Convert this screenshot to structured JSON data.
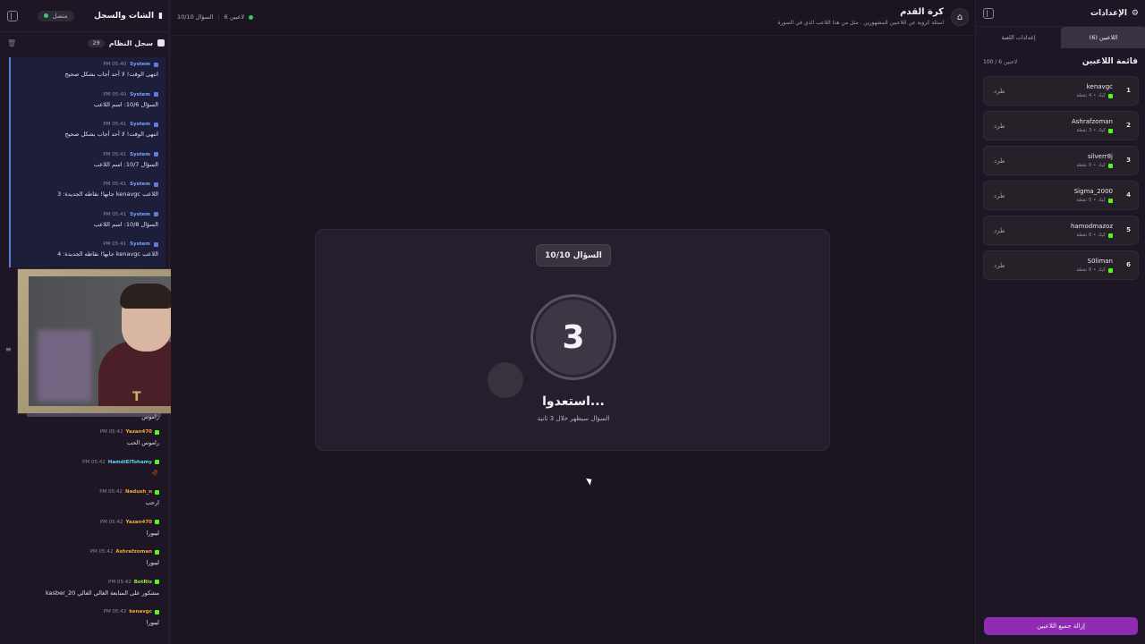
{
  "left": {
    "title": "الشات والسجل",
    "connection": "متصل",
    "syslog_title": "سجل النظام",
    "syslog_count": "29",
    "system_messages": [
      {
        "author": "System",
        "time": "PM 05:40",
        "text": "انتهى الوقت! لا أحد أجاب بشكل صحيح"
      },
      {
        "author": "System",
        "time": "PM 05:40",
        "text": "السؤال 10/6: اسم اللاعب"
      },
      {
        "author": "System",
        "time": "PM 05:41",
        "text": "انتهى الوقت! لا أحد أجاب بشكل صحيح"
      },
      {
        "author": "System",
        "time": "PM 05:41",
        "text": "السؤال 10/7: اسم اللاعب"
      },
      {
        "author": "System",
        "time": "PM 05:41",
        "text": "اللاعب kenavgc جابها! نقاطه الجديدة: 3"
      },
      {
        "author": "System",
        "time": "PM 05:41",
        "text": "السؤال 10/8: اسم اللاعب"
      },
      {
        "author": "System",
        "time": "PM 05:41",
        "text": "اللاعب kenavgc جابها! نقاطه الجديدة: 4"
      }
    ],
    "partial_chat": "راموس",
    "chat_messages": [
      {
        "author": "Yazan470",
        "color": "#f0a93b",
        "time": "PM 05:42",
        "text": "راموس الحب"
      },
      {
        "author": "HamdiElTohamy",
        "color": "#5fd3f3",
        "time": "PM 05:42",
        "text": "🥀"
      },
      {
        "author": "Nadush_n",
        "color": "#f0a93b",
        "time": "PM 05:42",
        "text": "ارحب"
      },
      {
        "author": "Yazan470",
        "color": "#f0a93b",
        "time": "PM 05:42",
        "text": "ليبورا"
      },
      {
        "author": "Ashrafzoman",
        "color": "#f0a93b",
        "time": "PM 05:42",
        "text": "ليبورا"
      },
      {
        "author": "BotRix",
        "color": "#9be24b",
        "time": "PM 05:42",
        "text": "مشكور على المتابعة الغالي الغالي kasber_20"
      },
      {
        "author": "kenavgc",
        "color": "#f0a93b",
        "time": "PM 05:42",
        "text": "ليبورا"
      }
    ]
  },
  "center": {
    "players_count": "6 لاعبين",
    "question_progress": "السؤال 10/10",
    "game_title": "كرة القدم",
    "game_subtitle": "اسئلة كروية عن اللاعبين المشهورين . مثل من هذا اللاعب الذي في الصورة",
    "question_pill": "السؤال 10/10",
    "countdown": "3",
    "get_ready": "استعدوا...",
    "countdown_text": "السؤال سيظهر خلال 3 ثانية"
  },
  "right": {
    "title": "الإعدادات",
    "tab_players": "اللاعبين (6)",
    "tab_game_settings": "إعدادات اللعبة",
    "list_title": "قائمة اللاعبين",
    "list_count": "100 / 6 لاعبين",
    "kick_label": "طرد",
    "players": [
      {
        "rank": "1",
        "name": "kenavgc",
        "meta": "كيك • 4 نقطة"
      },
      {
        "rank": "2",
        "name": "Ashrafzoman",
        "meta": "كيك • 3 نقطة"
      },
      {
        "rank": "3",
        "name": "silverr8j",
        "meta": "كيك • 0 نقطة"
      },
      {
        "rank": "4",
        "name": "Sigma_2000",
        "meta": "كيك • 0 نقطة"
      },
      {
        "rank": "5",
        "name": "hamodmazoz",
        "meta": "كيك • 0 نقطة"
      },
      {
        "rank": "6",
        "name": "S0liman",
        "meta": "كيك • 0 نقطة"
      }
    ],
    "remove_all": "إزالة جميع اللاعبين"
  }
}
